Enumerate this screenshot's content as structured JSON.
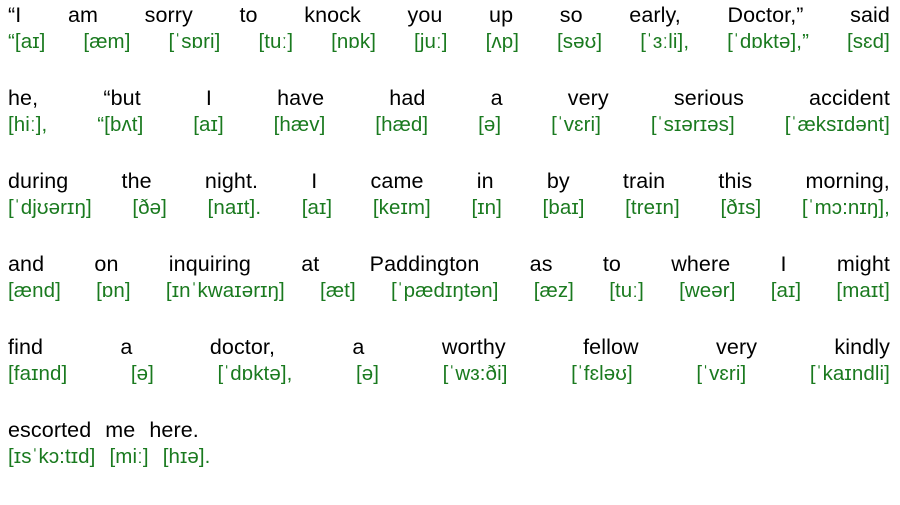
{
  "document": {
    "type": "interlinear-ipa-transcription",
    "text_color": "#000000",
    "ipa_color": "#1a7a1f",
    "background_color": "#ffffff",
    "full_text": "“I am sorry to knock you up so early, Doctor,” said he, “but I have had a very serious accident during the night. I came in by train this morning, and on inquiring at Paddington as to where I might find a doctor, a worthy fellow very kindly escorted me here.",
    "full_ipa": "“[aɪ] [æm] [ˈsɒri] [tuː] [nɒk] [juː] [ʌp] [səʊ] [ˈɜːli], [ˈdɒktə],” [sɛd] [hiː], “[bʌt] [aɪ] [hæv] [hæd] [ə] [ˈvɛri] [ˈsɪərɪəs] [ˈæksɪdənt] [ˈdjʊərɪŋ] [ðə] [naɪt]. [aɪ] [keɪm] [ɪn] [baɪ] [treɪn] [ðɪs] [ˈmɔ:nɪŋ], [ænd] [ɒn] [ɪnˈkwaɪərɪŋ] [æt] [ˈpædɪŋtən] [æz] [tuː] [weər] [aɪ] [maɪt] [faɪnd] [ə] [ˈdɒktə], [ə] [ˈwɜ:ði] [ˈfɛləʊ] [ˈvɛri] [ˈkaɪndli] [ɪsˈkɔ:tɪd] [miː] [hɪə]."
  },
  "lines": [
    {
      "index": 0,
      "justified": true,
      "words": [
        "“I",
        "am",
        "sorry",
        "to",
        "knock",
        "you",
        "up",
        "so",
        "early,",
        "Doctor,”",
        "said"
      ],
      "ipa": [
        "“[aɪ]",
        "[æm]",
        "[ˈsɒri]",
        "[tuː]",
        "[nɒk]",
        "[juː]",
        "[ʌp]",
        "[səʊ]",
        "[ˈɜːli],",
        "[ˈdɒktə],”",
        "[sɛd]"
      ]
    },
    {
      "index": 1,
      "justified": true,
      "words": [
        "he,",
        "“but",
        "I",
        "have",
        "had",
        "a",
        "very",
        "serious",
        "accident"
      ],
      "ipa": [
        "[hiː],",
        "“[bʌt]",
        "[aɪ]",
        "[hæv]",
        "[hæd]",
        "[ə]",
        "[ˈvɛri]",
        "[ˈsɪərɪəs]",
        "[ˈæksɪdənt]"
      ]
    },
    {
      "index": 2,
      "justified": true,
      "words": [
        "during",
        "the",
        "night.",
        "I",
        "came",
        "in",
        "by",
        "train",
        "this",
        "morning,"
      ],
      "ipa": [
        "[ˈdjʊərɪŋ]",
        "[ðə]",
        "[naɪt].",
        "[aɪ]",
        "[keɪm]",
        "[ɪn]",
        "[baɪ]",
        "[treɪn]",
        "[ðɪs]",
        "[ˈmɔ:nɪŋ],"
      ]
    },
    {
      "index": 3,
      "justified": true,
      "words": [
        "and",
        "on",
        "inquiring",
        "at",
        "Paddington",
        "as",
        "to",
        "where",
        "I",
        "might"
      ],
      "ipa": [
        "[ænd]",
        "[ɒn]",
        "[ɪnˈkwaɪərɪŋ]",
        "[æt]",
        "[ˈpædɪŋtən]",
        "[æz]",
        "[tuː]",
        "[weər]",
        "[aɪ]",
        "[maɪt]"
      ]
    },
    {
      "index": 4,
      "justified": true,
      "words": [
        "find",
        "a",
        "doctor,",
        "a",
        "worthy",
        "fellow",
        "very",
        "kindly"
      ],
      "ipa": [
        "[faɪnd]",
        "[ə]",
        "[ˈdɒktə],",
        "[ə]",
        "[ˈwɜ:ði]",
        "[ˈfɛləʊ]",
        "[ˈvɛri]",
        "[ˈkaɪndli]"
      ]
    },
    {
      "index": 5,
      "justified": false,
      "words": [
        "escorted",
        "me",
        "here."
      ],
      "ipa": [
        "[ɪsˈkɔ:tɪd]",
        "[miː]",
        "[hɪə]."
      ]
    }
  ]
}
